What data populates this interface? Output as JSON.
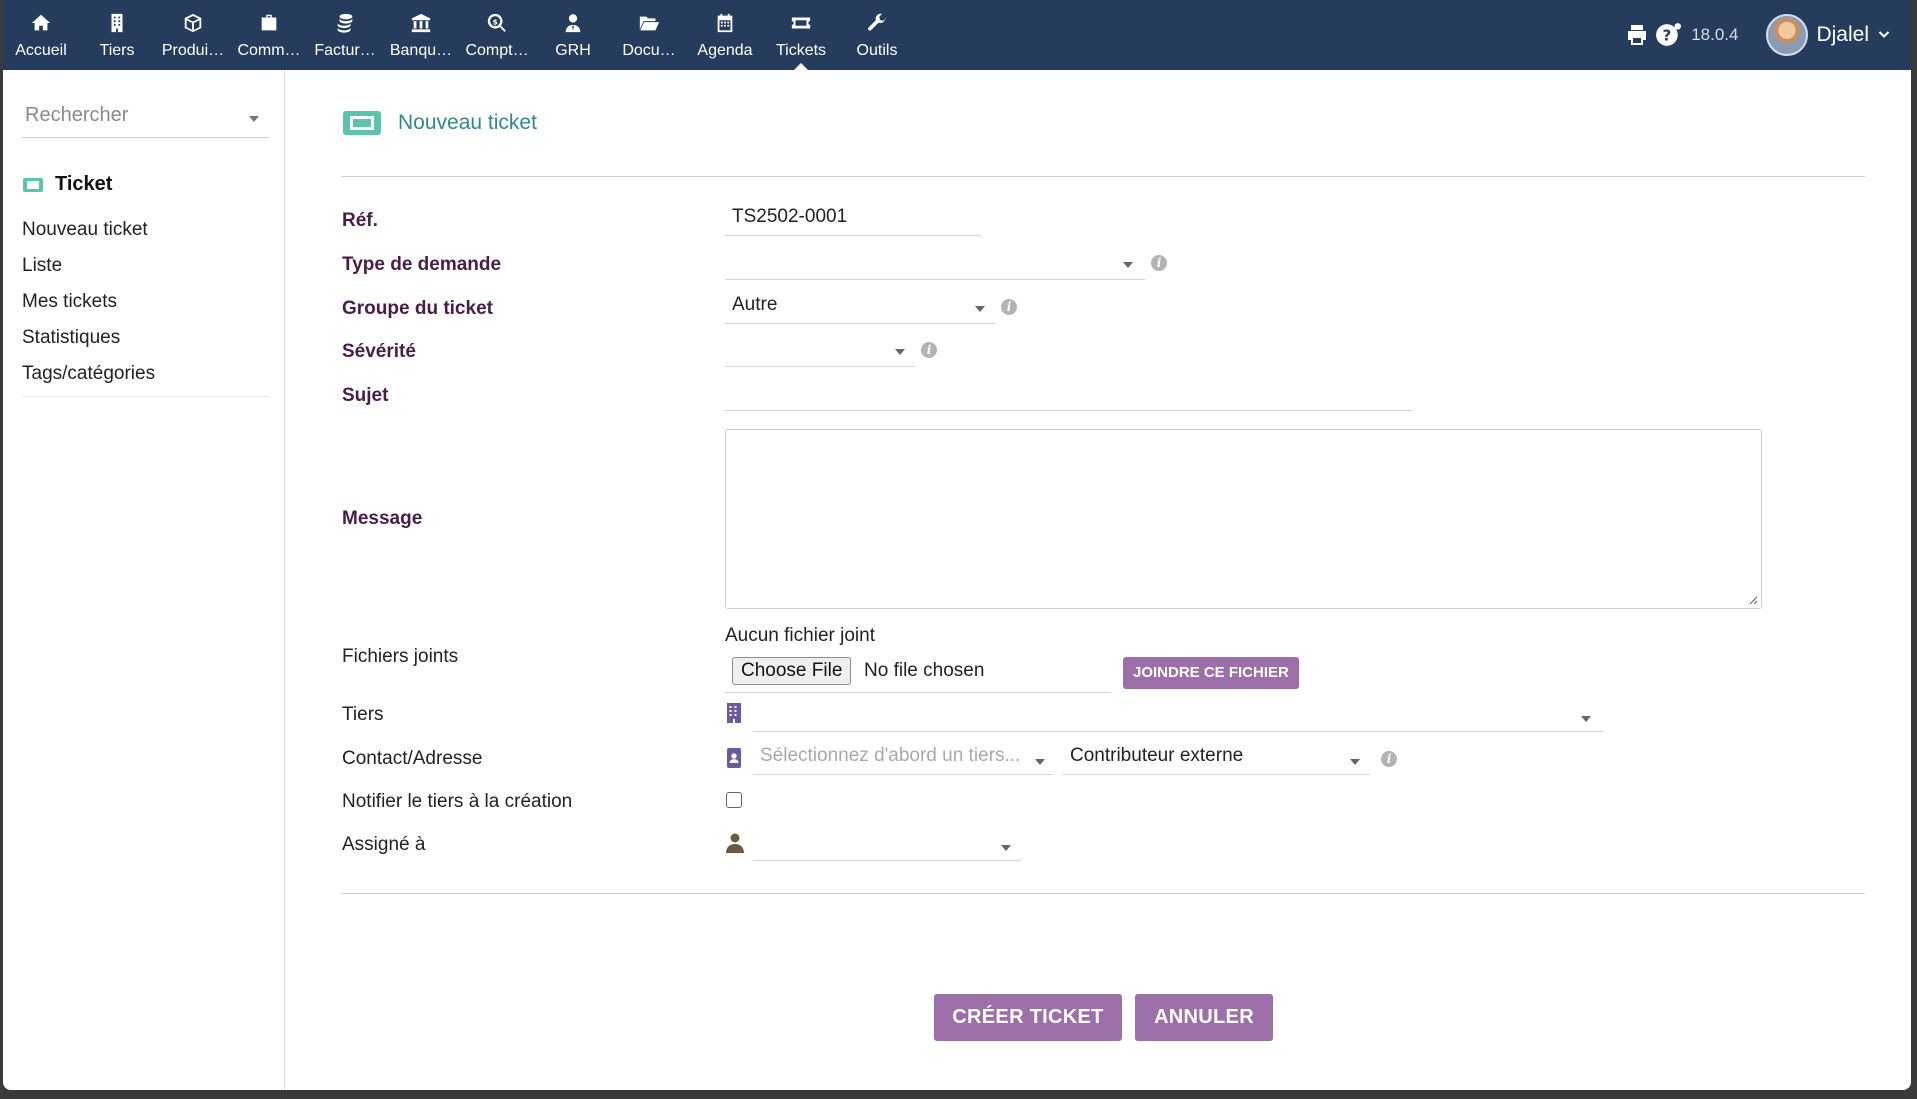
{
  "topbar": {
    "menu": [
      {
        "label": "Accueil",
        "icon": "home-icon"
      },
      {
        "label": "Tiers",
        "icon": "building-icon"
      },
      {
        "label": "Produi…",
        "icon": "cube-icon"
      },
      {
        "label": "Comm…",
        "icon": "briefcase-icon"
      },
      {
        "label": "Factur…",
        "icon": "coins-icon"
      },
      {
        "label": "Banqu…",
        "icon": "bank-icon"
      },
      {
        "label": "Compt…",
        "icon": "search-dollar-icon"
      },
      {
        "label": "GRH",
        "icon": "user-tie-icon"
      },
      {
        "label": "Docu…",
        "icon": "folder-open-icon"
      },
      {
        "label": "Agenda",
        "icon": "calendar-icon"
      },
      {
        "label": "Tickets",
        "icon": "ticket-icon",
        "active": true
      },
      {
        "label": "Outils",
        "icon": "wrench-icon"
      }
    ],
    "version": "18.0.4",
    "user_name": "Djalel"
  },
  "sidebar": {
    "search_placeholder": "Rechercher",
    "section_title": "Ticket",
    "links": [
      "Nouveau ticket",
      "Liste",
      "Mes tickets",
      "Statistiques",
      "Tags/catégories"
    ]
  },
  "page": {
    "title": "Nouveau ticket",
    "accent_color": "#2f8a8a"
  },
  "form": {
    "ref": {
      "label": "Réf.",
      "value": "TS2502-0001"
    },
    "type": {
      "label": "Type de demande",
      "value": ""
    },
    "group": {
      "label": "Groupe du ticket",
      "value": "Autre"
    },
    "severity": {
      "label": "Sévérité",
      "value": ""
    },
    "subject": {
      "label": "Sujet",
      "value": ""
    },
    "message": {
      "label": "Message",
      "value": ""
    },
    "attachments": {
      "label": "Fichiers joints",
      "no_file_text": "Aucun fichier joint",
      "choose_label": "Choose File",
      "chosen_text": "No file chosen",
      "attach_button": "JOINDRE CE FICHIER"
    },
    "thirdparty": {
      "label": "Tiers",
      "value": ""
    },
    "contact": {
      "label": "Contact/Adresse",
      "placeholder": "Sélectionnez d'abord un tiers...",
      "role_value": "Contributeur externe"
    },
    "notify": {
      "label": "Notifier le tiers à la création",
      "checked": false
    },
    "assigned": {
      "label": "Assigné à",
      "value": ""
    }
  },
  "actions": {
    "create": "CRÉER TICKET",
    "cancel": "ANNULER",
    "button_color": "#9c6fa8"
  }
}
